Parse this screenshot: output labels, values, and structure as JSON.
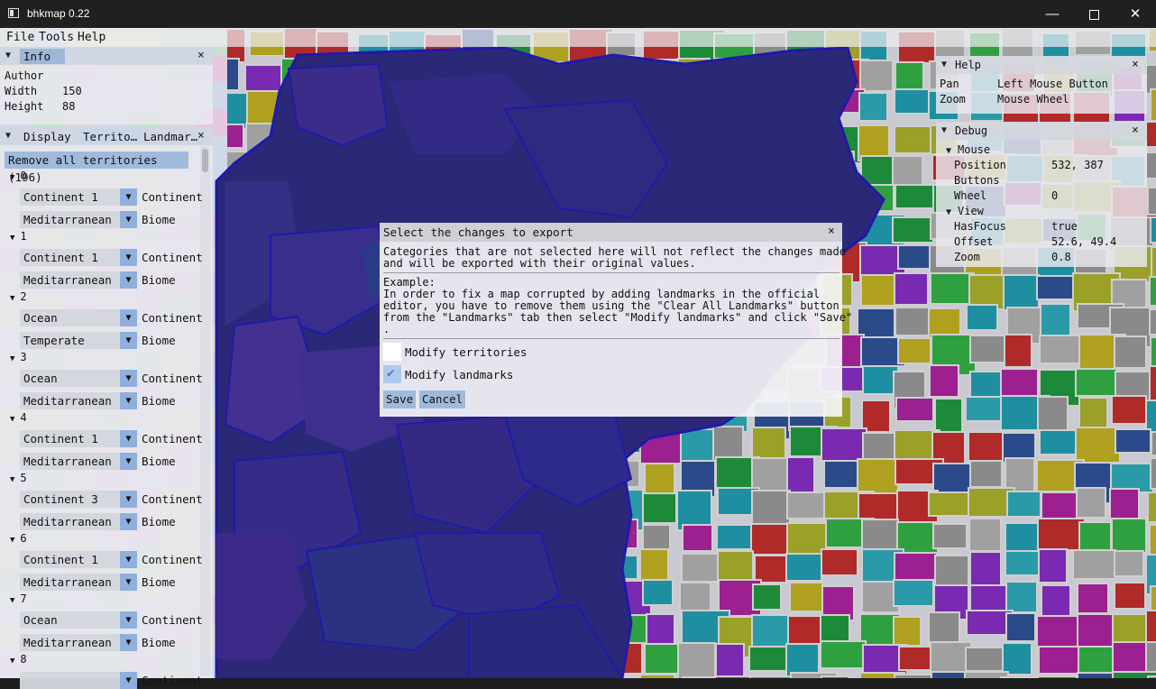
{
  "window": {
    "title": "bhkmap 0.22",
    "minimize_glyph": "—",
    "close_glyph": "✕"
  },
  "menu": {
    "items": [
      "File",
      "Tools",
      "Help"
    ]
  },
  "info_panel": {
    "title": "Info",
    "rows": [
      {
        "key": "Author",
        "value": ""
      },
      {
        "key": "Width",
        "value": "150"
      },
      {
        "key": "Height",
        "value": "88"
      }
    ]
  },
  "territories_panel": {
    "tabs": [
      "Display",
      "Territo…",
      "Landmar…"
    ],
    "remove_all_label": "Remove all territories (196)",
    "continent_label": "Continent",
    "biome_label": "Biome",
    "entries": [
      {
        "id": "0",
        "continent": "Continent 1",
        "biome": "Meditarranean"
      },
      {
        "id": "1",
        "continent": "Continent 1",
        "biome": "Meditarranean"
      },
      {
        "id": "2",
        "continent": "Ocean",
        "biome": "Temperate"
      },
      {
        "id": "3",
        "continent": "Ocean",
        "biome": "Meditarranean"
      },
      {
        "id": "4",
        "continent": "Continent 1",
        "biome": "Meditarranean"
      },
      {
        "id": "5",
        "continent": "Continent 3",
        "biome": "Meditarranean"
      },
      {
        "id": "6",
        "continent": "Continent 1",
        "biome": "Meditarranean"
      },
      {
        "id": "7",
        "continent": "Ocean",
        "biome": "Meditarranean"
      },
      {
        "id": "8",
        "continent": "",
        "biome": ""
      }
    ]
  },
  "help_panel": {
    "title": "Help",
    "rows": [
      {
        "key": "Pan",
        "value": "Left Mouse Button"
      },
      {
        "key": "Zoom",
        "value": "Mouse Wheel"
      }
    ]
  },
  "debug_panel": {
    "title": "Debug",
    "mouse_label": "Mouse",
    "mouse_rows": [
      {
        "key": "Position",
        "value": "532, 387"
      },
      {
        "key": "Buttons",
        "value": ""
      },
      {
        "key": "Wheel",
        "value": "0"
      }
    ],
    "view_label": "View",
    "view_rows": [
      {
        "key": "HasFocus",
        "value": "true"
      },
      {
        "key": "Offset",
        "value": "52.6, 49.4"
      },
      {
        "key": "Zoom",
        "value": "0.8"
      }
    ]
  },
  "export_dialog": {
    "title": "Select the changes to export",
    "intro": "Categories that are not selected here will not reflect the changes made\nand will be exported with their original values.",
    "example": "Example:\nIn order to fix a map corrupted by adding landmarks in the official\neditor, you have to remove them using the \"Clear All Landmarks\" button\nfrom the \"Landmarks\" tab then select \"Modify landmarks\" and click \"Save\"\n.",
    "options": [
      {
        "label": "Modify territories",
        "checked": false
      },
      {
        "label": "Modify landmarks",
        "checked": true
      }
    ],
    "save_label": "Save",
    "cancel_label": "Cancel"
  },
  "glyphs": {
    "close": "×",
    "expanded": "▼",
    "check": "✔"
  },
  "colors": {
    "accent": "#9fbadb",
    "water": "#2a2a7a",
    "titlebar": "#202020"
  }
}
